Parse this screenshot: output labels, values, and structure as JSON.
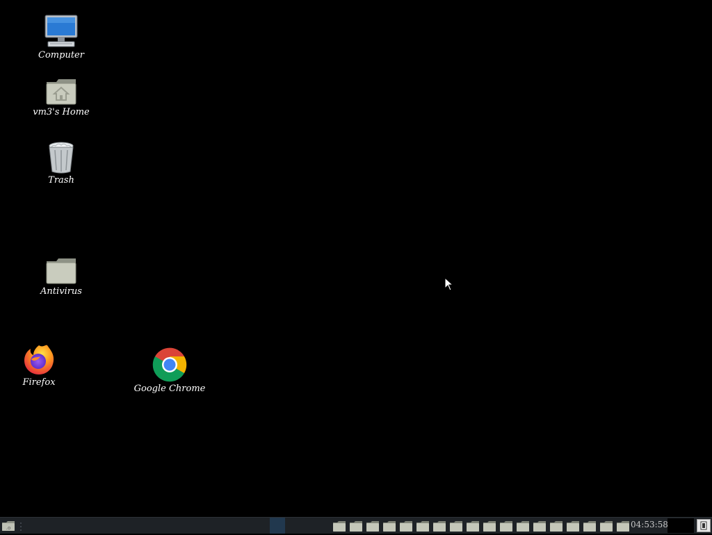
{
  "desktop": {
    "icons": [
      {
        "label": "Computer",
        "icon": "computer-icon"
      },
      {
        "label": "vm3's Home",
        "icon": "home-folder-icon"
      },
      {
        "label": "Trash",
        "icon": "trash-icon"
      },
      {
        "label": "Antivirus",
        "icon": "folder-icon"
      },
      {
        "label": "Firefox",
        "icon": "firefox-icon"
      },
      {
        "label": "Google Chrome",
        "icon": "chrome-icon"
      }
    ]
  },
  "taskbar": {
    "clock": "04:53:58",
    "folder_launcher_count": 18,
    "colors": {
      "background": "#1e2226",
      "active_window": "#21384e"
    }
  },
  "colors": {
    "desktop_background": "#000000",
    "icon_label": "#ffffff"
  }
}
